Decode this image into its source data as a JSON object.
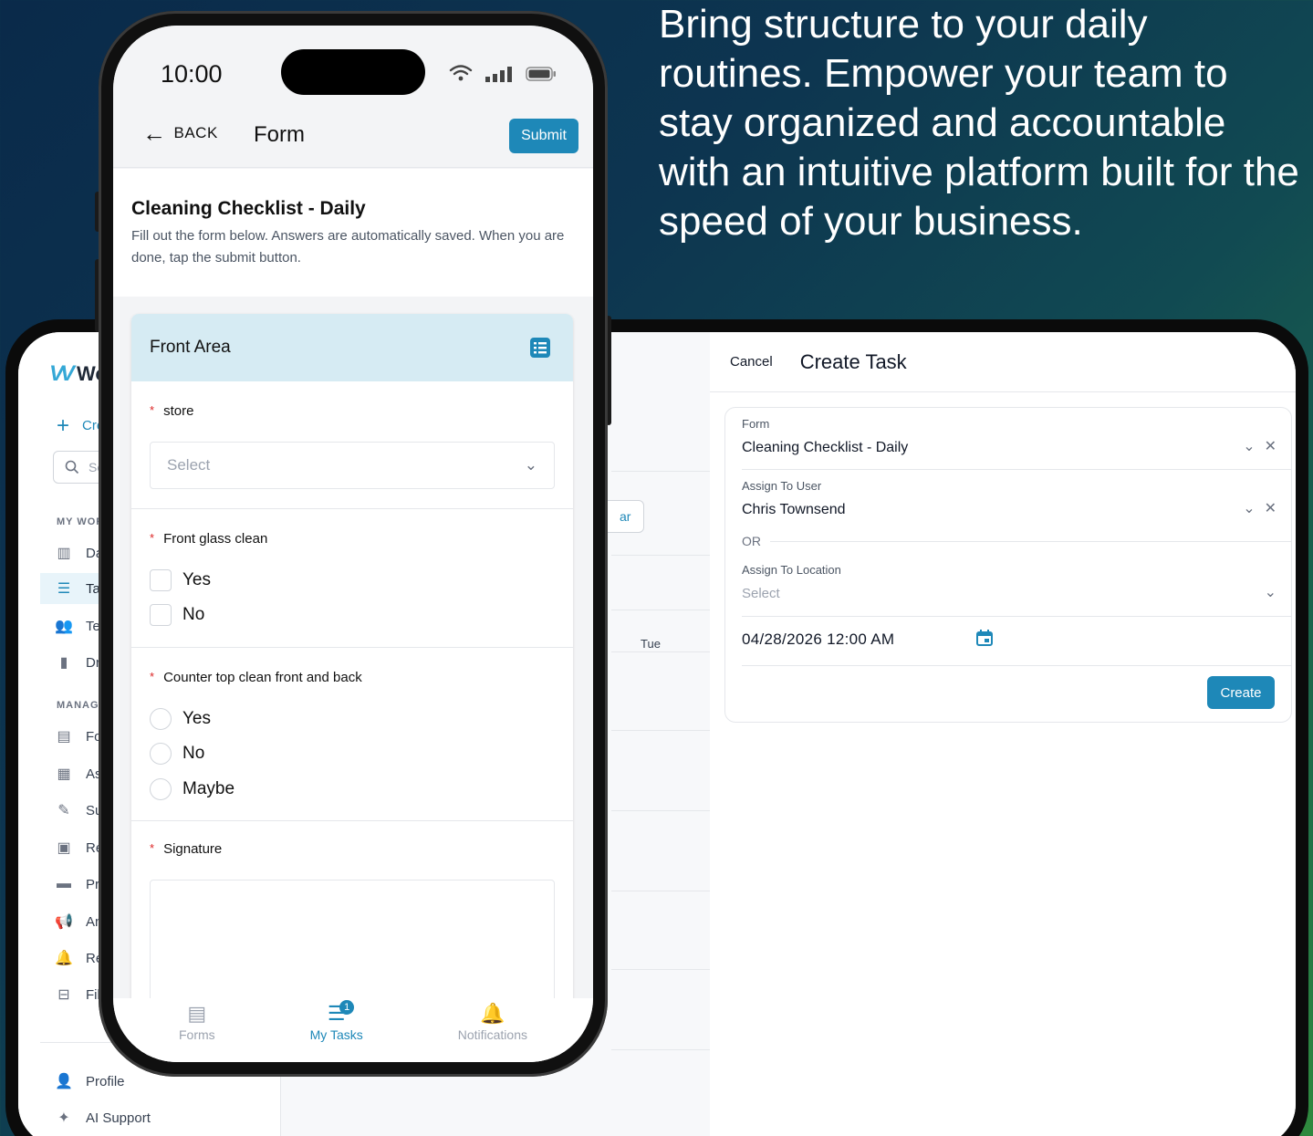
{
  "headline": "Bring structure to your daily routines. Empower your team to stay organized and accountable with an intuitive platform built for the speed of your business.",
  "colors": {
    "accent": "#1e88b8",
    "section_header_bg": "#d6ebf3",
    "required": "#dc2626"
  },
  "tablet": {
    "sidebar": {
      "brand": "Wo",
      "create_label": "Cre",
      "search_placeholder": "Sea",
      "section_my_work": "MY WORK",
      "section_manage": "MANAGE",
      "items": [
        {
          "label": "Das",
          "icon": "bar-chart-icon"
        },
        {
          "label": "Tas",
          "icon": "task-list-icon"
        },
        {
          "label": "Tea",
          "icon": "team-icon"
        },
        {
          "label": "Dra",
          "icon": "document-icon"
        },
        {
          "label": "For",
          "icon": "form-icon"
        },
        {
          "label": "Ass",
          "icon": "calendar-icon"
        },
        {
          "label": "Sub",
          "icon": "submission-icon"
        },
        {
          "label": "Rep",
          "icon": "clipboard-icon"
        },
        {
          "label": "Pro",
          "icon": "folder-icon"
        },
        {
          "label": "Ann",
          "icon": "megaphone-icon"
        },
        {
          "label": "Rer",
          "icon": "bell-icon"
        },
        {
          "label": "File",
          "icon": "file-tree-icon"
        }
      ],
      "profile_label": "Profile",
      "ai_support_label": "AI Support"
    },
    "center": {
      "bar_button": "ar",
      "day_label": "Tue"
    },
    "create_task": {
      "cancel_label": "Cancel",
      "title": "Create Task",
      "form_label": "Form",
      "form_value": "Cleaning Checklist - Daily",
      "assign_user_label": "Assign To User",
      "assign_user_value": "Chris Townsend",
      "or_label": "OR",
      "assign_location_label": "Assign To Location",
      "assign_location_placeholder": "Select",
      "date_value": "04/28/2026 12:00 AM",
      "create_label": "Create"
    }
  },
  "phone": {
    "time": "10:00",
    "back_label": "BACK",
    "title": "Form",
    "submit_label": "Submit",
    "form_title": "Cleaning Checklist - Daily",
    "form_description": "Fill out the form below. Answers are automatically saved. When you are done, tap the submit button.",
    "section_title": "Front Area",
    "questions": {
      "store": {
        "label": "store",
        "placeholder": "Select"
      },
      "front_glass": {
        "label": "Front glass clean",
        "options": [
          "Yes",
          "No"
        ]
      },
      "counter_top": {
        "label": "Counter top clean front and back",
        "options": [
          "Yes",
          "No",
          "Maybe"
        ]
      },
      "signature": {
        "label": "Signature"
      }
    },
    "tabs": [
      {
        "label": "Forms",
        "icon": "document-icon"
      },
      {
        "label": "My Tasks",
        "icon": "task-list-icon",
        "badge": "1"
      },
      {
        "label": "Notifications",
        "icon": "bell-icon"
      }
    ]
  }
}
